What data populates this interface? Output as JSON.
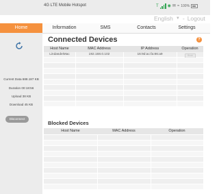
{
  "app": {
    "title": "4G LTE Mobile Hotspot"
  },
  "status_bar": {
    "battery_text": "100%"
  },
  "header": {
    "language": "English",
    "logout_label": "Logout"
  },
  "sidebar": {
    "home_label": "Home",
    "stats": {
      "current_data": "Current Data 688.187 KB",
      "duration": "Duration 00:18:56",
      "upload": "Upload 38 KB",
      "download": "Download 45 KB"
    },
    "disconnect_label": "Disconnect"
  },
  "nav": {
    "tabs": [
      "Information",
      "SMS",
      "Contacts",
      "Settings"
    ]
  },
  "connected": {
    "title": "Connected Devices",
    "columns": [
      "Host Name",
      "MAC Address",
      "IP Address",
      "Operation"
    ],
    "rows": [
      {
        "host": "LindasdeiMac",
        "mac": "192.168.0.102",
        "ip": "16:9d:ac:fa:86:a9",
        "operation": "Block"
      }
    ]
  },
  "blocked": {
    "title": "Blocked Devices",
    "columns": [
      "Host Name",
      "MAC Address",
      "Operation"
    ]
  },
  "colors": {
    "accent": "#f5913e",
    "signal": "#2ea24e"
  },
  "icons": [
    "signal-icon",
    "wifi-icon",
    "battery-icon",
    "refresh-icon",
    "help-icon",
    "chevron-down-icon"
  ]
}
